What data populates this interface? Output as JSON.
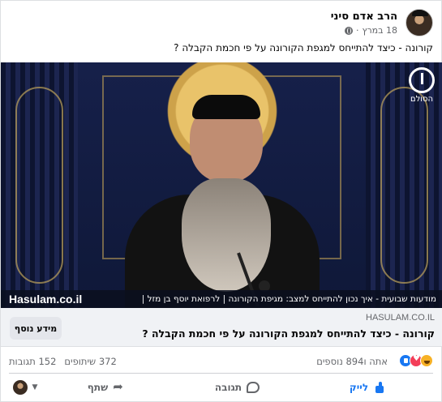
{
  "post": {
    "author": "הרב אדם סיני",
    "date": "18 במרץ",
    "privacy_icon": "globe-icon",
    "text": "קורונה - כיצד להתייחס למגפת הקורונה על פי חכמת הקבלה ?"
  },
  "video": {
    "logo_text": "הסולם",
    "ticker_text": "מודעות שבועית - איך נכון להתייחס למצב: מגיפת הקורונה | לרפואת יוסף בן מזל |",
    "ticker_site": "Hasulam.co.il"
  },
  "link_preview": {
    "domain": "HASULAM.CO.IL",
    "title": "קורונה - כיצד להתייחס למגפת הקורונה על פי חכמת הקבלה ?",
    "button": "מידע נוסף"
  },
  "reactions": {
    "types": [
      "like",
      "love",
      "haha"
    ],
    "summary": "אתה ו‏894 נוספים",
    "comments": "152 תגובות",
    "shares": "372 שיתופים"
  },
  "actions": {
    "like": "לייק",
    "comment": "תגובה",
    "share": "שתף"
  },
  "colors": {
    "accent": "#1877f2",
    "muted": "#65676b",
    "link_bg": "#f0f2f5"
  }
}
